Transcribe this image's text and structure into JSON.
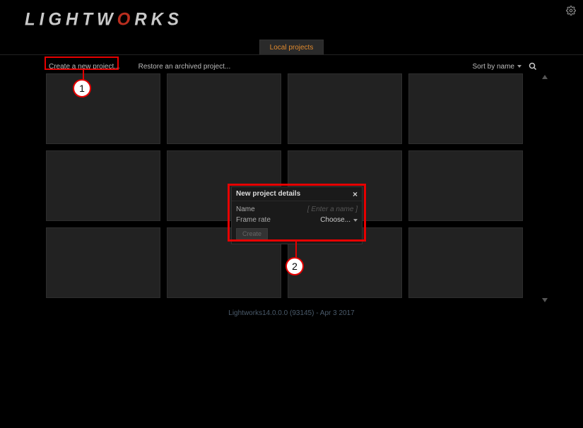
{
  "app": {
    "logo_pre": "LIGHTW",
    "logo_accent": "O",
    "logo_post": "RKS"
  },
  "tabs": {
    "active": "Local projects"
  },
  "toolbar": {
    "create": "Create a new project...",
    "restore": "Restore an archived project...",
    "sort": "Sort by name"
  },
  "dialog": {
    "title": "New project details",
    "name_label": "Name",
    "name_placeholder": "[ Enter a name ]",
    "rate_label": "Frame rate",
    "rate_value": "Choose...",
    "create_btn": "Create"
  },
  "footer": "Lightworks14.0.0.0 (93145) - Apr  3 2017",
  "annotations": {
    "c1": "1",
    "c2": "2"
  }
}
